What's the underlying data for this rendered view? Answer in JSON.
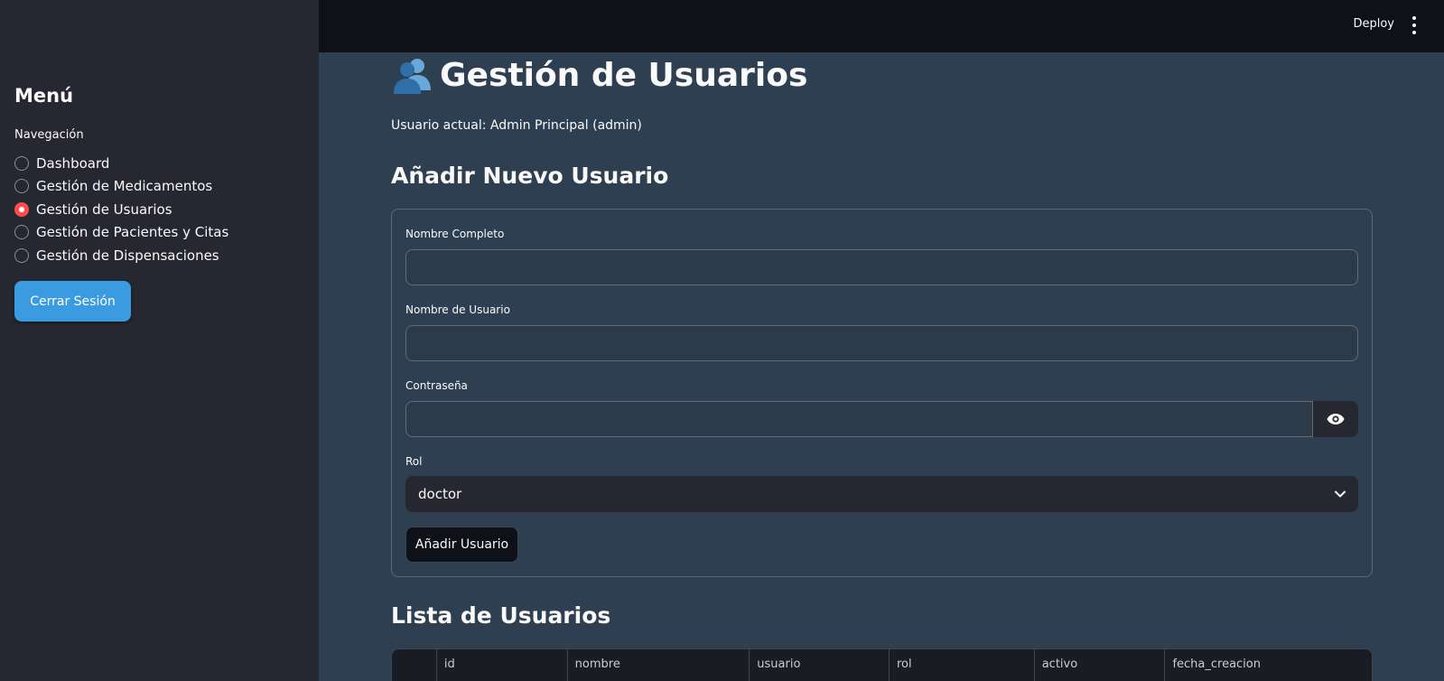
{
  "sidebar": {
    "title": "Menú",
    "nav_label": "Navegación",
    "items": [
      {
        "label": "Dashboard",
        "selected": false
      },
      {
        "label": "Gestión de Medicamentos",
        "selected": false
      },
      {
        "label": "Gestión de Usuarios",
        "selected": true
      },
      {
        "label": "Gestión de Pacientes y Citas",
        "selected": false
      },
      {
        "label": "Gestión de Dispensaciones",
        "selected": false
      }
    ],
    "logout_label": "Cerrar Sesión"
  },
  "header": {
    "deploy_label": "Deploy",
    "menu_icon": "kebab-menu-icon"
  },
  "main": {
    "title": "Gestión de Usuarios",
    "title_icon": "users-icon",
    "current_user": "Usuario actual: Admin Principal (admin)",
    "add_section_title": "Añadir Nuevo Usuario",
    "form": {
      "full_name_label": "Nombre Completo",
      "full_name_value": "",
      "username_label": "Nombre de Usuario",
      "username_value": "",
      "password_label": "Contraseña",
      "password_value": "",
      "role_label": "Rol",
      "role_value": "doctor",
      "submit_label": "Añadir Usuario"
    },
    "list_section_title": "Lista de Usuarios",
    "table": {
      "columns": [
        "",
        "id",
        "nombre",
        "usuario",
        "rol",
        "activo",
        "fecha_creacion"
      ]
    }
  },
  "colors": {
    "sidebar_bg": "#262730",
    "main_bg": "#2e3f52",
    "header_bg": "#0e1117",
    "accent_radio": "#ff4b4b",
    "logout_button": "#3a9be0",
    "icon_blue": "#4a90c8"
  }
}
